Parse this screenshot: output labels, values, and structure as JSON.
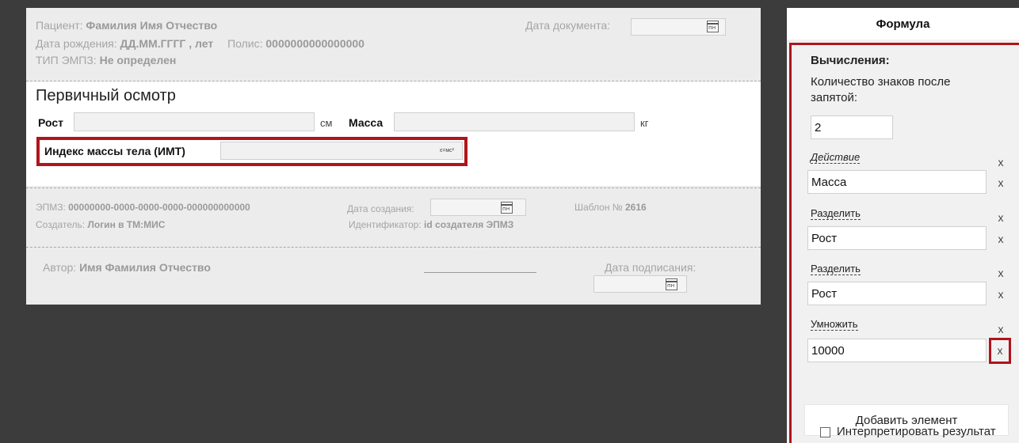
{
  "header": {
    "patient_label": "Пациент:",
    "patient_name": "Фамилия Имя Отчество",
    "dob_label": "Дата рождения:",
    "dob_value": "ДД.ММ.ГГГГ , лет",
    "policy_label": "Полис:",
    "policy_value": "0000000000000000",
    "type_label": "ТИП ЭМПЗ:",
    "type_value": "Не определен",
    "doc_date_label": "Дата документа:"
  },
  "form": {
    "title": "Первичный осмотр",
    "height_label": "Рост",
    "height_unit": "см",
    "mass_label": "Масса",
    "mass_unit": "кг",
    "imt_label": "Индекс массы тела (ИМТ)",
    "formula_hint": "ε=мс²"
  },
  "meta": {
    "empz_label": "ЭПМЗ:",
    "empz_value": "00000000-0000-0000-0000-000000000000",
    "creator_label": "Создатель:",
    "creator_value": "Логин в ТМ:МИС",
    "created_label": "Дата создания:",
    "identifier_label": "Идентификатор:",
    "identifier_value": "id создателя ЭПМЗ",
    "template_label": "Шаблон №",
    "template_value": "2616"
  },
  "signature": {
    "author_label": "Автор:",
    "author_value": "Имя Фамилия Отчество",
    "sign_date_label": "Дата подписания:"
  },
  "panel": {
    "title": "Формула",
    "calc_label": "Вычисления:",
    "decimals_label_1": "Количество знаков после",
    "decimals_label_2": "запятой:",
    "decimals_value": "2",
    "action_label": "Действие",
    "item1_value": "Масса",
    "op1": "Разделить",
    "item2_value": "Рост",
    "op2": "Разделить",
    "item3_value": "Рост",
    "op3": "Умножить",
    "item4_value": "10000",
    "remove": "x",
    "add_button": "Добавить элемент",
    "interpret_label": "Интерпретировать результат"
  },
  "colors": {
    "highlight": "#b0141d",
    "background_dark": "#3c3c3c"
  }
}
